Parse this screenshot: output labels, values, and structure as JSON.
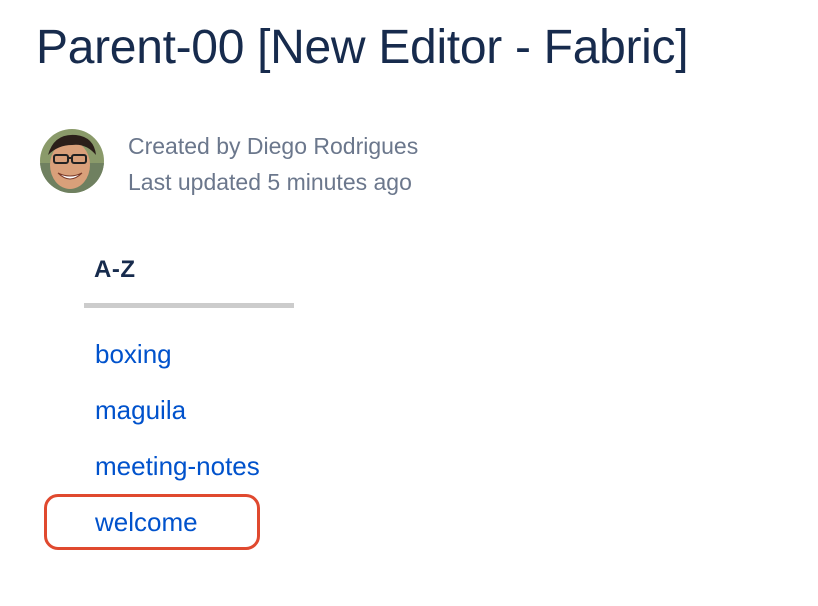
{
  "page": {
    "title": "Parent-00 [New Editor - Fabric]"
  },
  "byline": {
    "created": "Created by Diego Rodrigues",
    "updated": "Last updated 5 minutes ago"
  },
  "children_macro": {
    "sort_label": "A-Z",
    "items": [
      {
        "label": "boxing"
      },
      {
        "label": "maguila"
      },
      {
        "label": "meeting-notes"
      },
      {
        "label": "welcome"
      }
    ]
  },
  "colors": {
    "title": "#172B4D",
    "meta": "#6B778C",
    "link": "#0052CC",
    "highlight": "#E0492F"
  }
}
